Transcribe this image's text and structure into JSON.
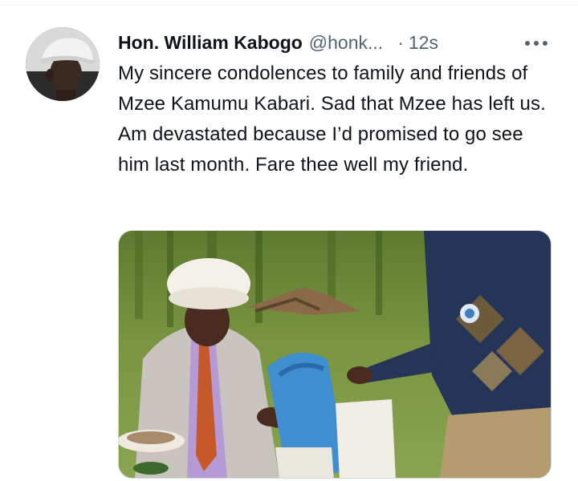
{
  "tweet": {
    "author": {
      "display_name": "Hon. William Kabogo",
      "handle": "@honk...",
      "avatar_icon": "profile-photo"
    },
    "separator": "·",
    "timestamp": "12s",
    "more_icon": "more-horizontal-icon",
    "text": "My sincere condolences to family and friends of Mzee Kamumu Kabari. Sad that Mzee has left us. Am devastated because I’d promised to go see him last month. Fare thee well my friend.",
    "media": {
      "type": "photo"
    }
  },
  "colors": {
    "primary_text": "#0f1419",
    "secondary_text": "#536471",
    "border": "#cfd9de"
  }
}
